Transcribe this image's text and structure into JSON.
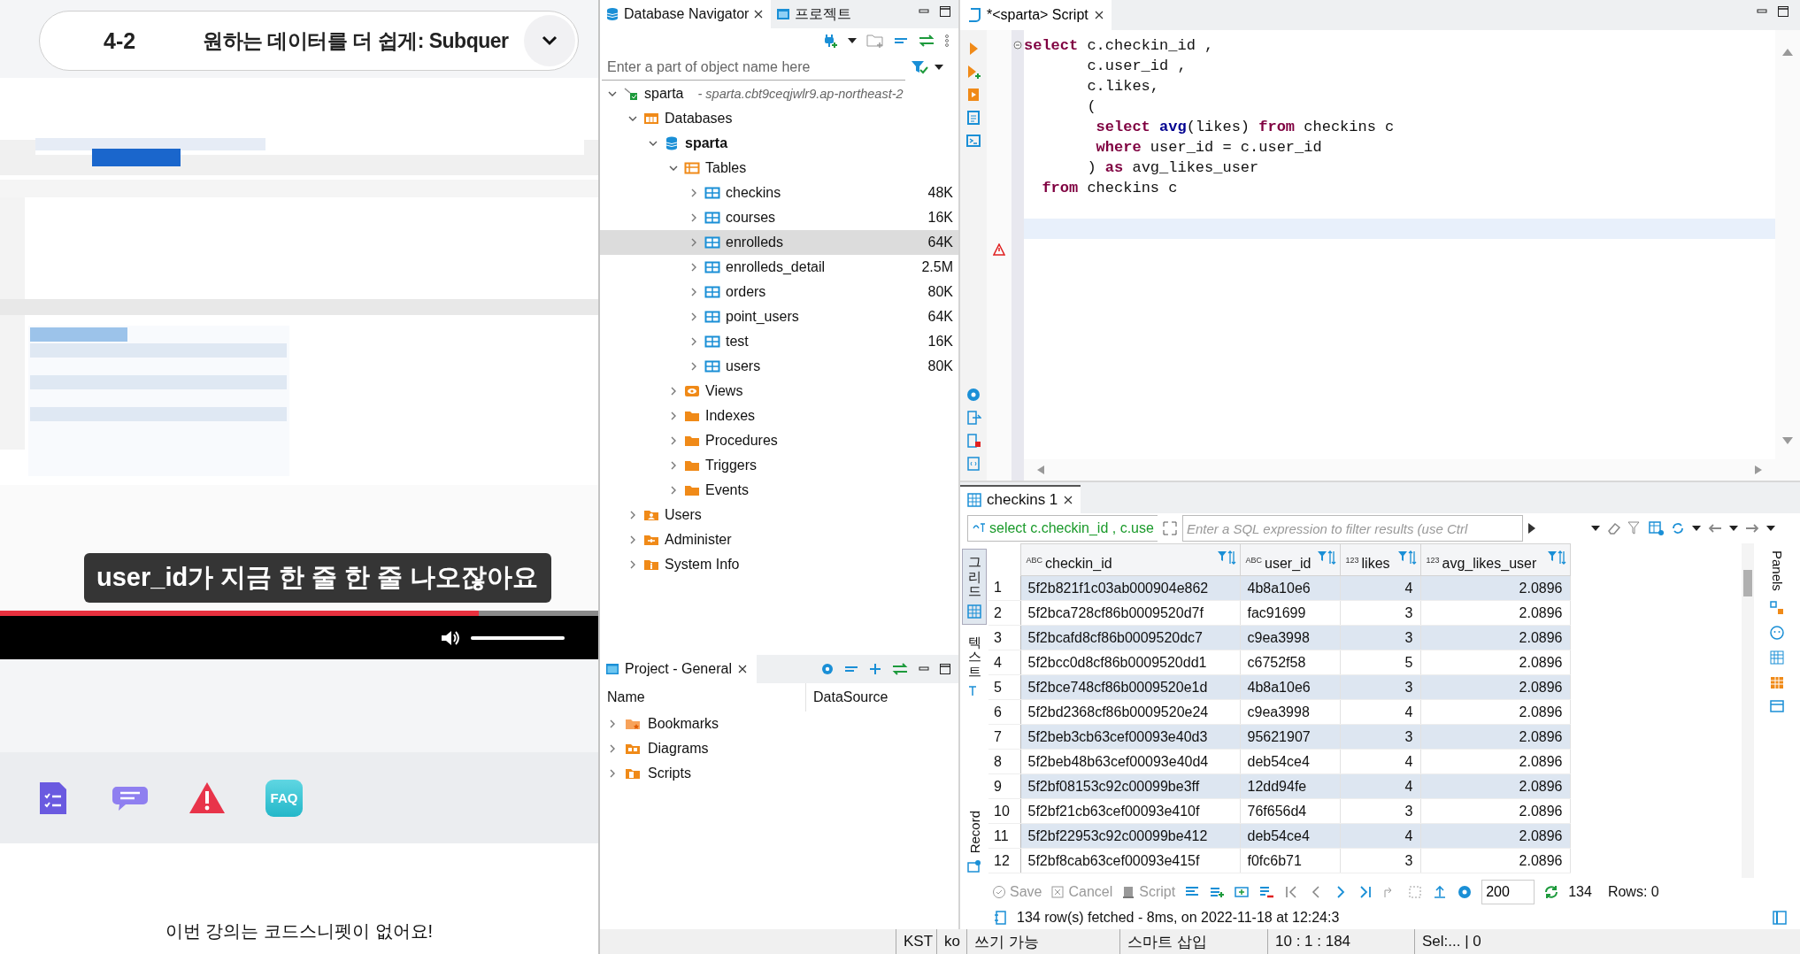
{
  "lecture": {
    "chapter": "4-2",
    "title": "원하는 데이터를 더 쉽게: Subquer",
    "video": {
      "kind": "picture",
      "subtitle": "user_id가 지금 한 줄 한 줄 나오잖아요",
      "progress": {
        "level": 0.8
      },
      "volume": {
        "level": 1
      }
    },
    "actions": [
      {
        "kind": "notes"
      },
      {
        "kind": "chat"
      },
      {
        "kind": "report"
      },
      {
        "kind": "faq",
        "label": "FAQ"
      }
    ],
    "notice": "이번 강의는 코드스니펫이 없어요!"
  },
  "navigator": {
    "tabs": [
      {
        "label": "Database Navigator",
        "selected": true,
        "kind": "database"
      },
      {
        "label": "프로젝트",
        "selected": false,
        "kind": "project"
      }
    ],
    "search": {
      "placeholder": "Enter a part of object name here"
    },
    "tree": [
      {
        "label": "sparta",
        "detail": "- sparta.cbt9ceqjwlr9.ap-northeast-2",
        "kind": "connection",
        "expanded": true,
        "selected": false,
        "children": [
          {
            "label": "Databases",
            "kind": "databases",
            "expanded": true,
            "selected": false,
            "children": [
              {
                "label": "sparta",
                "kind": "database",
                "expanded": true,
                "selected": false,
                "children": [
                  {
                    "label": "Tables",
                    "kind": "tables",
                    "expanded": true,
                    "selected": false,
                    "children": [
                      {
                        "label": "checkins",
                        "size": "48K",
                        "kind": "table",
                        "expanded": false,
                        "selected": false
                      },
                      {
                        "label": "courses",
                        "size": "16K",
                        "kind": "table",
                        "expanded": false,
                        "selected": false
                      },
                      {
                        "label": "enrolleds",
                        "size": "64K",
                        "kind": "table",
                        "expanded": false,
                        "selected": true
                      },
                      {
                        "label": "enrolleds_detail",
                        "size": "2.5M",
                        "kind": "table",
                        "expanded": false,
                        "selected": false
                      },
                      {
                        "label": "orders",
                        "size": "80K",
                        "kind": "table",
                        "expanded": false,
                        "selected": false
                      },
                      {
                        "label": "point_users",
                        "size": "64K",
                        "kind": "table",
                        "expanded": false,
                        "selected": false
                      },
                      {
                        "label": "test",
                        "size": "16K",
                        "kind": "table",
                        "expanded": false,
                        "selected": false
                      },
                      {
                        "label": "users",
                        "size": "80K",
                        "kind": "table",
                        "expanded": false,
                        "selected": false
                      }
                    ]
                  },
                  {
                    "label": "Views",
                    "kind": "views",
                    "expanded": false,
                    "selected": false
                  },
                  {
                    "label": "Indexes",
                    "kind": "folder",
                    "expanded": false,
                    "selected": false
                  },
                  {
                    "label": "Procedures",
                    "kind": "folder",
                    "expanded": false,
                    "selected": false
                  },
                  {
                    "label": "Triggers",
                    "kind": "folder",
                    "expanded": false,
                    "selected": false
                  },
                  {
                    "label": "Events",
                    "kind": "folder",
                    "expanded": false,
                    "selected": false
                  }
                ]
              }
            ]
          },
          {
            "label": "Users",
            "kind": "users",
            "expanded": false,
            "selected": false
          },
          {
            "label": "Administer",
            "kind": "admin",
            "expanded": false,
            "selected": false
          },
          {
            "label": "System Info",
            "kind": "info",
            "expanded": false,
            "selected": false
          }
        ]
      }
    ]
  },
  "project": {
    "tab": {
      "label": "Project - General",
      "selected": true
    },
    "columns": [
      "Name",
      "DataSource"
    ],
    "items": [
      {
        "label": "Bookmarks",
        "kind": "bookmarks",
        "expanded": false
      },
      {
        "label": "Diagrams",
        "kind": "diagrams",
        "expanded": false
      },
      {
        "label": "Scripts",
        "kind": "scripts",
        "expanded": false
      }
    ]
  },
  "editor": {
    "tab": {
      "label": "*<sparta> Script",
      "selected": true
    },
    "lines": [
      [
        {
          "kind": "keyword",
          "text": "select"
        },
        {
          "kind": "plain",
          "text": " c.checkin_id ,"
        }
      ],
      [
        {
          "kind": "plain",
          "text": "       c.user_id ,"
        }
      ],
      [
        {
          "kind": "plain",
          "text": "       c.likes,"
        }
      ],
      [
        {
          "kind": "plain",
          "text": "       ("
        }
      ],
      [
        {
          "kind": "keyword",
          "text": "        select"
        },
        {
          "kind": "function",
          "text": " avg"
        },
        {
          "kind": "plain",
          "text": "(likes) "
        },
        {
          "kind": "keyword",
          "text": "from"
        },
        {
          "kind": "plain",
          "text": " checkins c"
        }
      ],
      [
        {
          "kind": "keyword",
          "text": "        where"
        },
        {
          "kind": "plain",
          "text": " user_id = c.user_id"
        }
      ],
      [
        {
          "kind": "plain",
          "text": "       ) "
        },
        {
          "kind": "keyword",
          "text": "as"
        },
        {
          "kind": "plain",
          "text": " avg_likes_user"
        }
      ],
      [
        {
          "kind": "keyword",
          "text": "  from"
        },
        {
          "kind": "plain",
          "text": " checkins c"
        }
      ]
    ]
  },
  "results": {
    "tab": {
      "label": "checkins 1",
      "selected": true
    },
    "filter": {
      "query": "select c.checkin_id , c.use",
      "placeholder": "Enter a SQL expression to filter results (use Ctrl"
    },
    "view_tabs": [
      {
        "label": "그리드",
        "selected": true,
        "kind": "grid"
      },
      {
        "label": "텍스트",
        "selected": false,
        "kind": "text"
      },
      {
        "label": "Record",
        "selected": false,
        "kind": "record"
      }
    ],
    "columns": [
      {
        "name": "checkin_id",
        "type_label": "ABC",
        "kind": "text"
      },
      {
        "name": "user_id",
        "type_label": "ABC",
        "kind": "text"
      },
      {
        "name": "likes",
        "type_label": "123",
        "kind": "number"
      },
      {
        "name": "avg_likes_user",
        "type_label": "123",
        "kind": "number"
      }
    ],
    "rows": [
      {
        "number": "1",
        "cells": [
          "5f2b821f1c03ab000904e862",
          "4b8a10e6",
          "4",
          "2.0896"
        ]
      },
      {
        "number": "2",
        "cells": [
          "5f2bca728cf86b0009520d7f",
          "fac91699",
          "3",
          "2.0896"
        ]
      },
      {
        "number": "3",
        "cells": [
          "5f2bcafd8cf86b0009520dc7",
          "c9ea3998",
          "3",
          "2.0896"
        ]
      },
      {
        "number": "4",
        "cells": [
          "5f2bcc0d8cf86b0009520dd1",
          "c6752f58",
          "5",
          "2.0896"
        ]
      },
      {
        "number": "5",
        "cells": [
          "5f2bce748cf86b0009520e1d",
          "4b8a10e6",
          "3",
          "2.0896"
        ]
      },
      {
        "number": "6",
        "cells": [
          "5f2bd2368cf86b0009520e24",
          "c9ea3998",
          "4",
          "2.0896"
        ]
      },
      {
        "number": "7",
        "cells": [
          "5f2beb3cb63cef00093e40d3",
          "95621907",
          "3",
          "2.0896"
        ]
      },
      {
        "number": "8",
        "cells": [
          "5f2beb48b63cef00093e40d4",
          "deb54ce4",
          "4",
          "2.0896"
        ]
      },
      {
        "number": "9",
        "cells": [
          "5f2bf08153c92c00099be3ff",
          "12dd94fe",
          "4",
          "2.0896"
        ]
      },
      {
        "number": "10",
        "cells": [
          "5f2bf21cb63cef00093e410f",
          "76f656d4",
          "3",
          "2.0896"
        ]
      },
      {
        "number": "11",
        "cells": [
          "5f2bf22953c92c00099be412",
          "deb54ce4",
          "4",
          "2.0896"
        ]
      },
      {
        "number": "12",
        "cells": [
          "5f2bf8cab63cef00093e415f",
          "f0fc6b71",
          "3",
          "2.0896"
        ]
      }
    ],
    "panels_label": "Panels",
    "actions": [
      {
        "label": "Save",
        "disabled": true,
        "kind": "save"
      },
      {
        "label": "Cancel",
        "disabled": true,
        "kind": "cancel"
      },
      {
        "label": "Script",
        "disabled": true,
        "kind": "script"
      }
    ],
    "fetch_size": "200",
    "fetched": "134",
    "rows_label": "Rows: 0",
    "message": "134 row(s) fetched - 8ms, on 2022-11-18 at 12:24:3"
  },
  "status_bar": [
    {
      "text": "KST"
    },
    {
      "text": "ko"
    },
    {
      "text": "쓰기 가능"
    },
    {
      "text": "스마트 삽입"
    },
    {
      "text": "10 : 1 : 184"
    },
    {
      "text": "Sel:... | 0"
    }
  ]
}
